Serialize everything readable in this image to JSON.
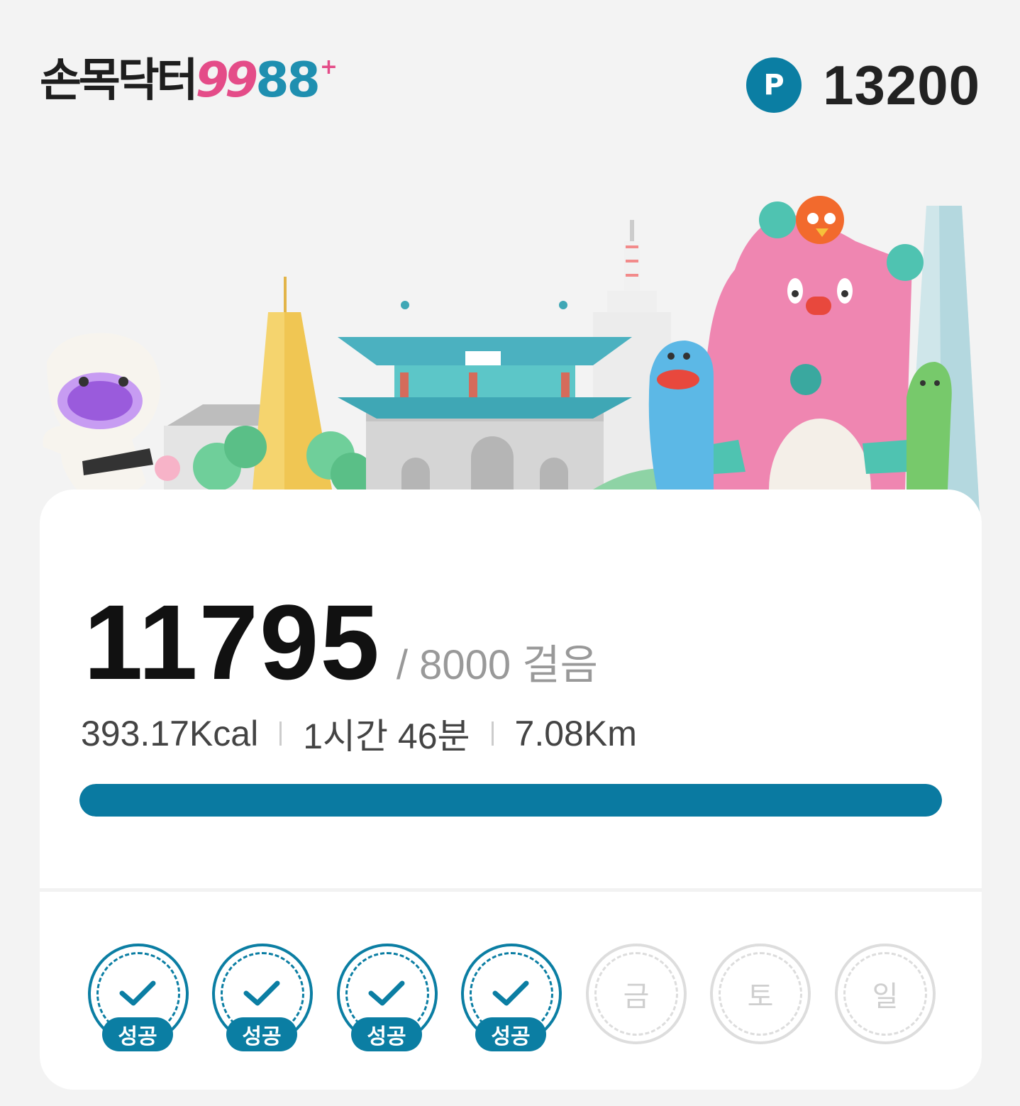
{
  "header": {
    "logo": {
      "text": "손목닥터",
      "nine_a": "9",
      "nine_b": "9",
      "eights": "88",
      "plus": "+"
    },
    "points": {
      "badge": "P",
      "value": "13200"
    }
  },
  "banner": {
    "illustration": "seoul-landmarks-characters"
  },
  "summary": {
    "steps": "11795",
    "goal_text": "/ 8000 걸음",
    "calories": "393.17Kcal",
    "duration": "1시간 46분",
    "distance": "7.08Km",
    "progress_fraction": 1.0
  },
  "week": {
    "success_label": "성공",
    "days": [
      {
        "status": "success",
        "label": "성공"
      },
      {
        "status": "success",
        "label": "성공"
      },
      {
        "status": "success",
        "label": "성공"
      },
      {
        "status": "success",
        "label": "성공"
      },
      {
        "status": "pending",
        "label": "금"
      },
      {
        "status": "pending",
        "label": "토"
      },
      {
        "status": "pending",
        "label": "일"
      }
    ]
  },
  "colors": {
    "accent": "#0b7ea3",
    "logo_pink": "#e44c88",
    "logo_blue": "#1f8fb0",
    "background": "#f3f3f3"
  }
}
